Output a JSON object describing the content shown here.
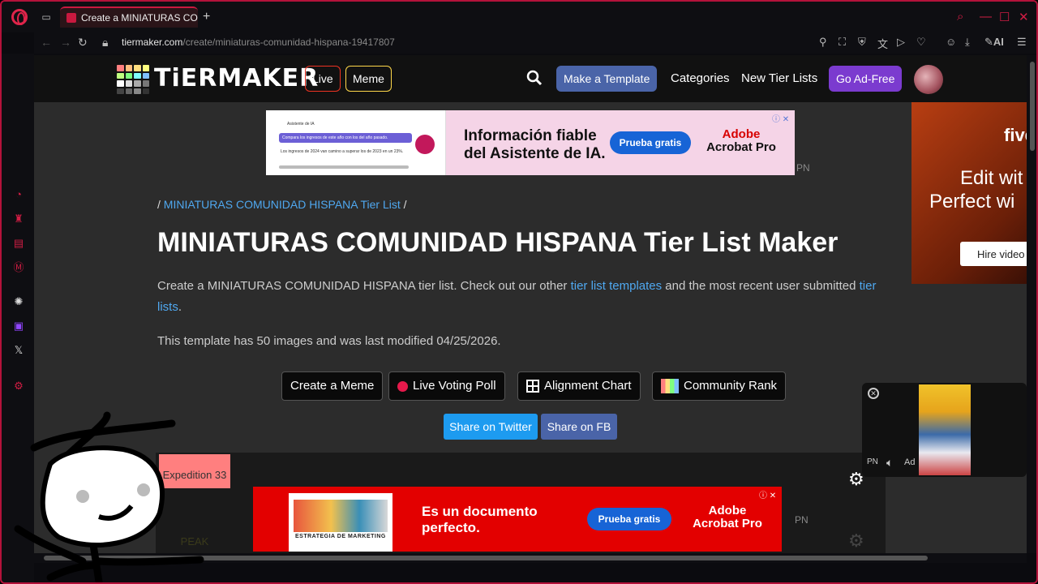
{
  "browser": {
    "tab_title": "Create a MINIATURAS COMUNIDAD HISPANA Tier List Maker",
    "new_tab": "+",
    "url_host": "tiermaker.com",
    "url_path": "/create/miniaturas-comunidad-hispana-19417807",
    "ai_label": "AI"
  },
  "site": {
    "logo": "TiERMAKER",
    "live": "Live",
    "meme": "Meme",
    "make_template": "Make a Template",
    "categories": "Categories",
    "new_tier_lists": "New Tier Lists",
    "go_ad_free": "Go Ad-Free"
  },
  "ad_top": {
    "chat_title": "Asistente de IA",
    "chat_query": "Compara los ingresos de este año con los del año pasado.",
    "chat_answer": "Los ingresos de 2024 van camino a superar los de 2023 en un 23%.",
    "headline_1": "Información fiable",
    "headline_2": "del Asistente de IA.",
    "cta": "Prueba gratis",
    "brand_1": "Adobe",
    "brand_2": "Acrobat Pro",
    "badge": "PN"
  },
  "ad_right": {
    "brand": "five",
    "tag_1": "Edit wit",
    "tag_2": "Perfect wi",
    "button": "Hire video"
  },
  "breadcrumb": {
    "prefix": "/ ",
    "link": "MINIATURAS COMUNIDAD HISPANA Tier List",
    "suffix": " /"
  },
  "page_title": "MINIATURAS COMUNIDAD HISPANA Tier List Maker",
  "description": {
    "part1": "Create a MINIATURAS COMUNIDAD HISPANA tier list. Check out our other ",
    "link1": "tier list templates",
    "part2": " and the most recent user submitted ",
    "link2": "tier lists",
    "part3": "."
  },
  "info": "This template has 50 images and was last modified 04/25/2026.",
  "actions": {
    "create_meme": "Create a Meme",
    "live_voting": "Live Voting Poll",
    "alignment": "Alignment Chart",
    "community": "Community Rank"
  },
  "share": {
    "twitter": "Share on Twitter",
    "fb": "Share on FB"
  },
  "tiers": [
    "Expedition 33",
    "PEAK"
  ],
  "video_ad": {
    "pn": "PN",
    "ad": "Ad"
  },
  "ad_bottom": {
    "thumb_caption": "ESTRATEGIA DE MARKETING",
    "headline_1": "Es un documento",
    "headline_2": "perfecto.",
    "cta": "Prueba gratis",
    "brand_1": "Adobe",
    "brand_2": "Acrobat Pro",
    "badge": "PN"
  },
  "colors": {
    "accent": "#d01d44",
    "link": "#4fa8f0",
    "make_template": "#4a64a8",
    "ad_free": "#7b3bcf",
    "twitter": "#1d9bf0",
    "fb": "#4a64a8"
  }
}
